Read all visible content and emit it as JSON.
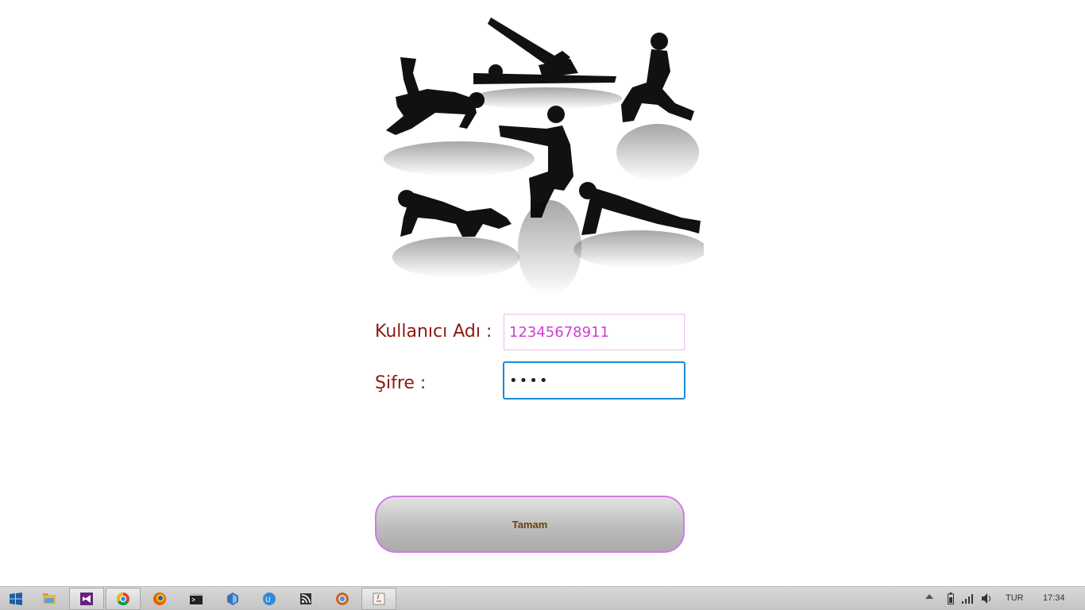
{
  "form": {
    "username_label": "Kullanıcı Adı :",
    "username_value": "12345678911",
    "password_label": "Şifre :",
    "password_value": "1234",
    "submit_label": "Tamam"
  },
  "colors": {
    "label": "#8b1a10",
    "username_text": "#d23ad6",
    "password_focus_border": "#1e88d8",
    "button_border": "#d27ae6",
    "button_text": "#6e3f0a"
  },
  "taskbar": {
    "apps": [
      {
        "icon": "windows-start-icon"
      },
      {
        "icon": "file-explorer-icon"
      },
      {
        "icon": "visual-studio-icon"
      },
      {
        "icon": "chrome-icon"
      },
      {
        "icon": "firefox-icon"
      },
      {
        "icon": "command-prompt-icon"
      },
      {
        "icon": "virtualbox-icon"
      },
      {
        "icon": "uc-browser-icon"
      },
      {
        "icon": "rss-icon"
      },
      {
        "icon": "chromium-icon"
      },
      {
        "icon": "java-app-icon"
      }
    ],
    "tray": {
      "language": "TUR",
      "time": "17:34"
    }
  }
}
